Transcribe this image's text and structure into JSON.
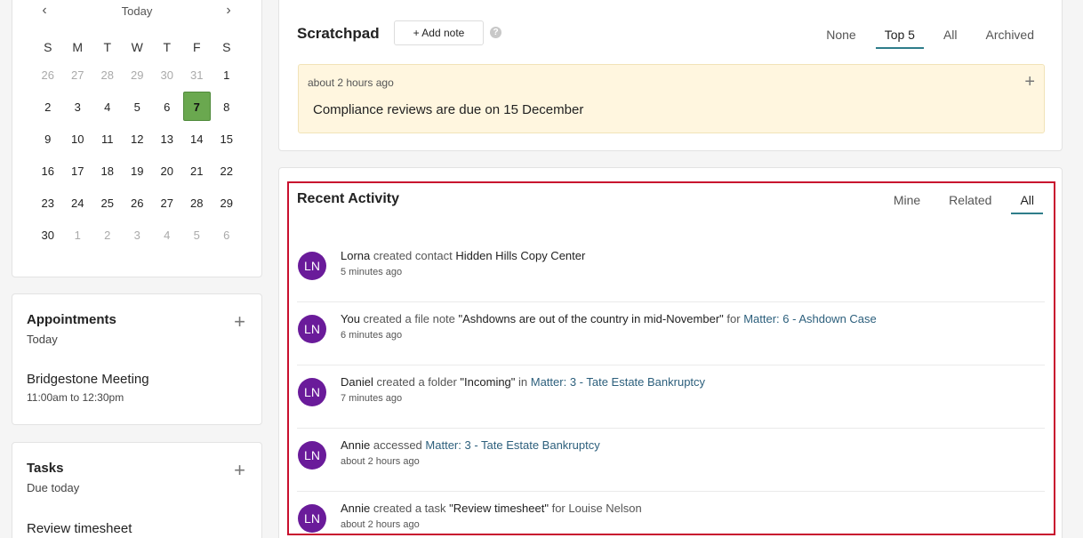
{
  "calendar": {
    "today_label": "Today",
    "prev_icon": "chevron-left-icon",
    "next_icon": "chevron-right-icon",
    "weekdays": [
      "S",
      "M",
      "T",
      "W",
      "T",
      "F",
      "S"
    ],
    "days": [
      {
        "n": "26",
        "muted": true
      },
      {
        "n": "27",
        "muted": true
      },
      {
        "n": "28",
        "muted": true
      },
      {
        "n": "29",
        "muted": true
      },
      {
        "n": "30",
        "muted": true
      },
      {
        "n": "31",
        "muted": true
      },
      {
        "n": "1"
      },
      {
        "n": "2"
      },
      {
        "n": "3"
      },
      {
        "n": "4"
      },
      {
        "n": "5"
      },
      {
        "n": "6"
      },
      {
        "n": "7",
        "selected": true
      },
      {
        "n": "8"
      },
      {
        "n": "9"
      },
      {
        "n": "10"
      },
      {
        "n": "11"
      },
      {
        "n": "12"
      },
      {
        "n": "13"
      },
      {
        "n": "14"
      },
      {
        "n": "15"
      },
      {
        "n": "16"
      },
      {
        "n": "17"
      },
      {
        "n": "18"
      },
      {
        "n": "19"
      },
      {
        "n": "20"
      },
      {
        "n": "21"
      },
      {
        "n": "22"
      },
      {
        "n": "23"
      },
      {
        "n": "24"
      },
      {
        "n": "25"
      },
      {
        "n": "26"
      },
      {
        "n": "27"
      },
      {
        "n": "28"
      },
      {
        "n": "29"
      },
      {
        "n": "30"
      },
      {
        "n": "1",
        "muted": true
      },
      {
        "n": "2",
        "muted": true
      },
      {
        "n": "3",
        "muted": true
      },
      {
        "n": "4",
        "muted": true
      },
      {
        "n": "5",
        "muted": true
      },
      {
        "n": "6",
        "muted": true
      }
    ]
  },
  "appointments": {
    "title": "Appointments",
    "subtitle": "Today",
    "add_icon": "plus-icon",
    "item_title": "Bridgestone Meeting",
    "item_time": "11:00am to 12:30pm"
  },
  "tasks": {
    "title": "Tasks",
    "subtitle": "Due today",
    "add_icon": "plus-icon",
    "item_title": "Review timesheet"
  },
  "scratchpad": {
    "title": "Scratchpad",
    "add_note_label": "+ Add note",
    "help_label": "?",
    "tabs": [
      {
        "label": "None",
        "active": false
      },
      {
        "label": "Top 5",
        "active": true
      },
      {
        "label": "All",
        "active": false
      },
      {
        "label": "Archived",
        "active": false
      }
    ],
    "note": {
      "time": "about 2 hours ago",
      "text": "Compliance reviews are due on 15 December"
    }
  },
  "recent_activity": {
    "title": "Recent Activity",
    "tabs": [
      {
        "label": "Mine",
        "active": false
      },
      {
        "label": "Related",
        "active": false
      },
      {
        "label": "All",
        "active": true
      }
    ],
    "items": [
      {
        "initials": "LN",
        "parts": [
          {
            "t": "Lorna",
            "k": "who"
          },
          {
            "t": " created contact ",
            "k": "txt"
          },
          {
            "t": "Hidden Hills Copy Center",
            "k": "obj"
          }
        ],
        "time": "5 minutes ago"
      },
      {
        "initials": "LN",
        "parts": [
          {
            "t": "You",
            "k": "who"
          },
          {
            "t": " created a file note ",
            "k": "txt"
          },
          {
            "t": "\"Ashdowns are out of the country in mid-November\"",
            "k": "obj"
          },
          {
            "t": " for ",
            "k": "txt"
          },
          {
            "t": "Matter: 6 - Ashdown Case",
            "k": "lnk"
          }
        ],
        "time": "6 minutes ago"
      },
      {
        "initials": "LN",
        "parts": [
          {
            "t": "Daniel",
            "k": "who"
          },
          {
            "t": " created a folder ",
            "k": "txt"
          },
          {
            "t": "\"Incoming\"",
            "k": "obj"
          },
          {
            "t": " in ",
            "k": "txt"
          },
          {
            "t": "Matter: 3 - Tate Estate Bankruptcy",
            "k": "lnk"
          }
        ],
        "time": "7 minutes ago"
      },
      {
        "initials": "LN",
        "parts": [
          {
            "t": "Annie",
            "k": "who"
          },
          {
            "t": " accessed ",
            "k": "txt"
          },
          {
            "t": "Matter: 3 - Tate Estate Bankruptcy",
            "k": "lnk"
          }
        ],
        "time": "about 2 hours ago"
      },
      {
        "initials": "LN",
        "parts": [
          {
            "t": "Annie",
            "k": "who"
          },
          {
            "t": " created a task ",
            "k": "txt"
          },
          {
            "t": "\"Review timesheet\"",
            "k": "obj"
          },
          {
            "t": " for Louise Nelson",
            "k": "txt"
          }
        ],
        "time": "about 2 hours ago"
      }
    ]
  },
  "colors": {
    "selected_day": "#6aa84f",
    "avatar": "#6a1b9a",
    "link": "#2c5f7c",
    "note_bg": "#fff6df",
    "highlight_frame": "#c8102e",
    "active_tab": "#2e7d8a"
  }
}
